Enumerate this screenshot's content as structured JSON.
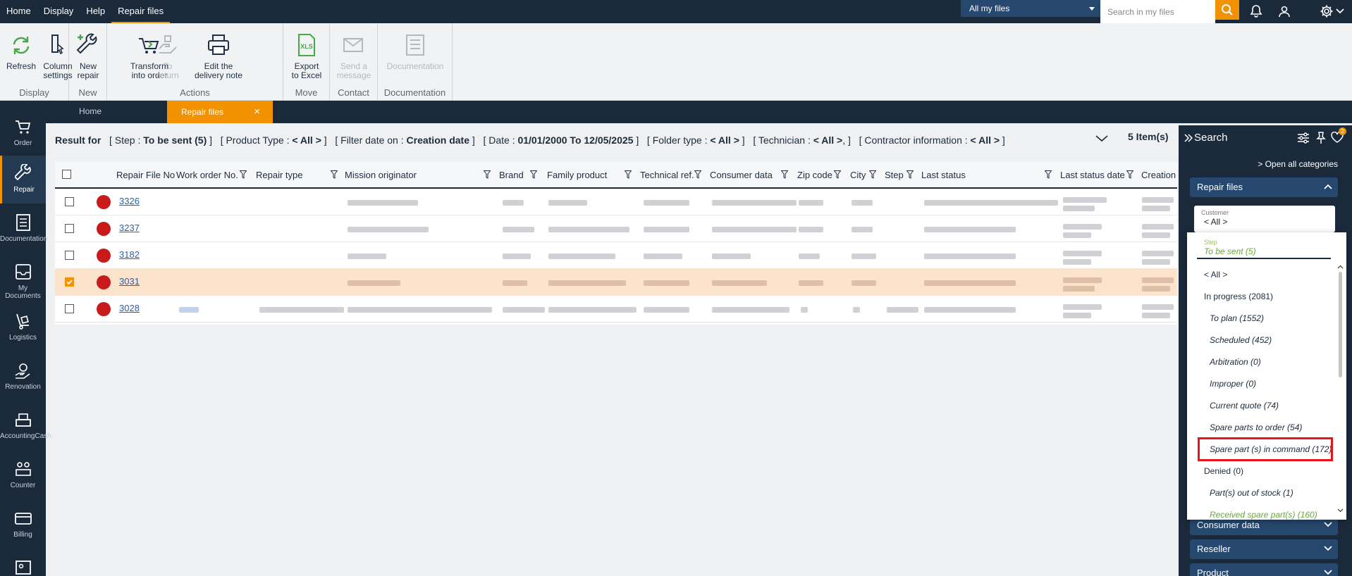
{
  "menu": [
    "Home",
    "Display",
    "Help",
    "Repair files"
  ],
  "topbar": {
    "scope_select": "All my files",
    "search_placeholder": "Search in my files",
    "notification_badge": "2"
  },
  "ribbon": {
    "groups": [
      {
        "label": "Display",
        "buttons": [
          {
            "line1": "Refresh",
            "line2": ""
          },
          {
            "line1": "Column",
            "line2": "settings"
          }
        ]
      },
      {
        "label": "New",
        "buttons": [
          {
            "line1": "New",
            "line2": "repair"
          }
        ]
      },
      {
        "label": "Actions",
        "buttons": [
          {
            "line1": "Transform",
            "line2": "into order"
          },
          {
            "line1": "To",
            "line2": "return"
          },
          {
            "line1": "Edit the",
            "line2": "delivery note"
          }
        ]
      },
      {
        "label": "Move",
        "buttons": [
          {
            "line1": "Export",
            "line2": "to Excel"
          }
        ]
      },
      {
        "label": "Contact",
        "buttons": [
          {
            "line1": "Send a",
            "line2": "message"
          }
        ]
      },
      {
        "label": "Documentation",
        "buttons": [
          {
            "line1": "Documentation",
            "line2": ""
          }
        ]
      }
    ]
  },
  "sidebar": [
    "Order",
    "Repair",
    "Documentation",
    "My Documents",
    "Logistics",
    "Renovation",
    "AccountingCash",
    "Counter",
    "Billing"
  ],
  "tabs": {
    "home": "Home",
    "active": "Repair files",
    "close": "×"
  },
  "result": {
    "prefix": "Result for",
    "filters": [
      {
        "label": "Step : ",
        "value": "To be sent (5)",
        "suffix": " ]"
      },
      {
        "label": "Product Type : ",
        "value": "< All >",
        "suffix": " ]"
      },
      {
        "label": "Filter date on : ",
        "value": "Creation date",
        "suffix": " ]"
      },
      {
        "label": "Date : ",
        "value": "01/01/2000 To 12/05/2025",
        "suffix": " ]"
      },
      {
        "label": "Folder type : ",
        "value": "< All >",
        "suffix": " ]"
      },
      {
        "label": "Technician : ",
        "value": "< All >",
        "suffix": ",  ]"
      },
      {
        "label": "Contractor information : ",
        "value": "< All >",
        "suffix": " ]"
      }
    ],
    "count": "5 Item(s)"
  },
  "table": {
    "columns": [
      "Repair File No",
      "Work order No.",
      "Repair type",
      "Mission originator",
      "Brand",
      "Family product",
      "Technical ref.",
      "Consumer data",
      "Zip code",
      "City",
      "Step",
      "Last status",
      "Last status date",
      "Creation c"
    ],
    "rows": [
      {
        "file_no": "3326",
        "checked": false
      },
      {
        "file_no": "3237",
        "checked": false
      },
      {
        "file_no": "3182",
        "checked": false
      },
      {
        "file_no": "3031",
        "checked": true
      },
      {
        "file_no": "3028",
        "checked": false
      }
    ]
  },
  "search_panel": {
    "title": "Search",
    "open_all": "> Open all categories",
    "repair_files": "Repair files",
    "customer_label": "Customer",
    "customer_value": "< All >",
    "lower_sections": [
      "Consumer data",
      "Reseller",
      "Product"
    ]
  },
  "step_dropdown": {
    "label": "Step",
    "value": "To be sent (5)",
    "options": [
      {
        "text": "< All >",
        "level": 0
      },
      {
        "text": "In progress (2081)",
        "level": 0
      },
      {
        "text": "To plan (1552)",
        "level": 1
      },
      {
        "text": "Scheduled (452)",
        "level": 1
      },
      {
        "text": "Arbitration (0)",
        "level": 1
      },
      {
        "text": "Improper (0)",
        "level": 1
      },
      {
        "text": "Current quote (74)",
        "level": 1
      },
      {
        "text": "Spare parts to order (54)",
        "level": 1
      },
      {
        "text": "Spare part (s) in command (172)",
        "level": 1
      },
      {
        "text": "Denied (0)",
        "level": 0
      },
      {
        "text": "Part(s) out of stock (1)",
        "level": 1
      },
      {
        "text": "Received spare part(s) (160)",
        "level": 1
      }
    ]
  },
  "colors": {
    "accent": "#f39200",
    "navy": "#1b2a3b",
    "status_red": "#c8191b",
    "highlight_red": "#e8141b",
    "selected_row": "#fbe3cc"
  }
}
